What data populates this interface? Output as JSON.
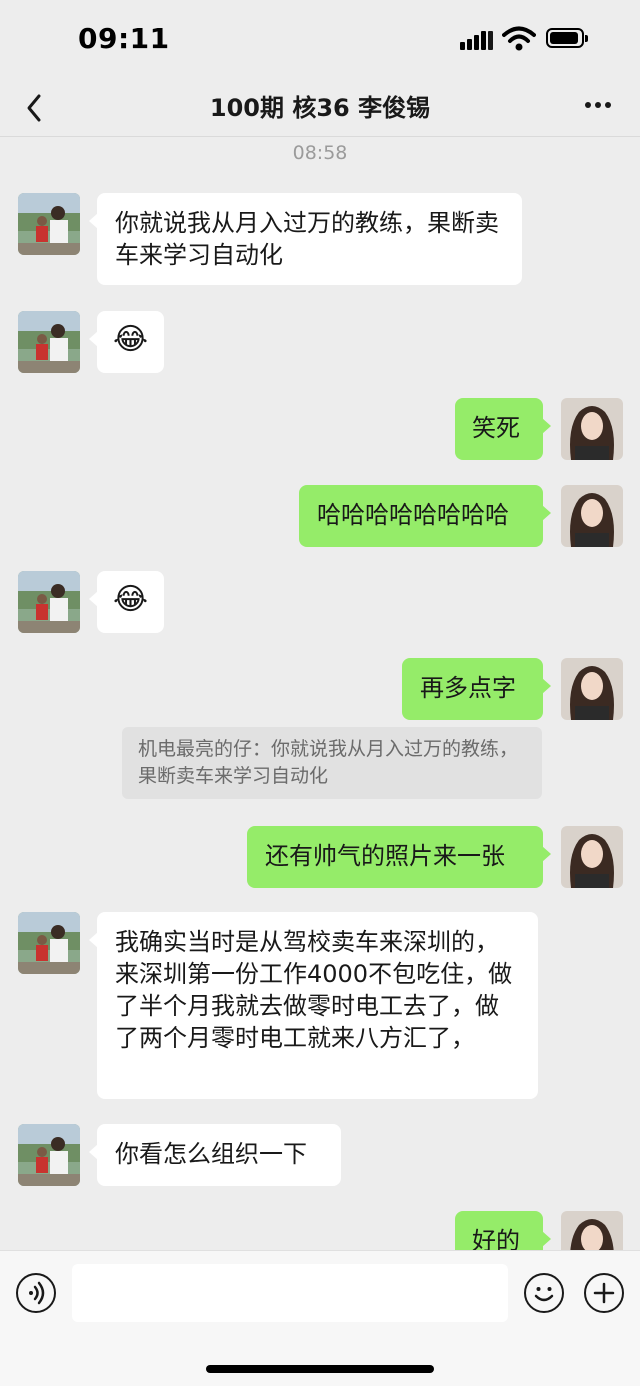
{
  "status_bar": {
    "time": "09:11"
  },
  "header": {
    "title": "100期 核36 李俊锡"
  },
  "chat": {
    "timestamp": "08:58",
    "messages": [
      {
        "side": "in",
        "text": "你就说我从月入过万的教练，果断卖车来学习自动化"
      },
      {
        "side": "in",
        "text": "😂"
      },
      {
        "side": "out",
        "text": "笑死"
      },
      {
        "side": "out",
        "text": "哈哈哈哈哈哈哈哈"
      },
      {
        "side": "in",
        "text": "😂"
      },
      {
        "side": "out",
        "text": "再多点字"
      },
      {
        "side": "out",
        "text": "还有帅气的照片来一张"
      },
      {
        "side": "in",
        "text": "我确实当时是从驾校卖车来深圳的，来深圳第一份工作4000不包吃住，做了半个月我就去做零时电工去了，做了两个月零时电工就来八方汇了，"
      },
      {
        "side": "in",
        "text": "你看怎么组织一下"
      },
      {
        "side": "out",
        "text": "好的"
      }
    ],
    "quote": "机电最亮的仔：你就说我从月入过万的教练，果断卖车来学习自动化"
  },
  "input_bar": {
    "value": "",
    "icons": [
      "voice-icon",
      "emoji-icon",
      "plus-icon"
    ]
  },
  "colors": {
    "background": "#ededed",
    "out_bubble": "#95ec69",
    "in_bubble": "#ffffff"
  }
}
